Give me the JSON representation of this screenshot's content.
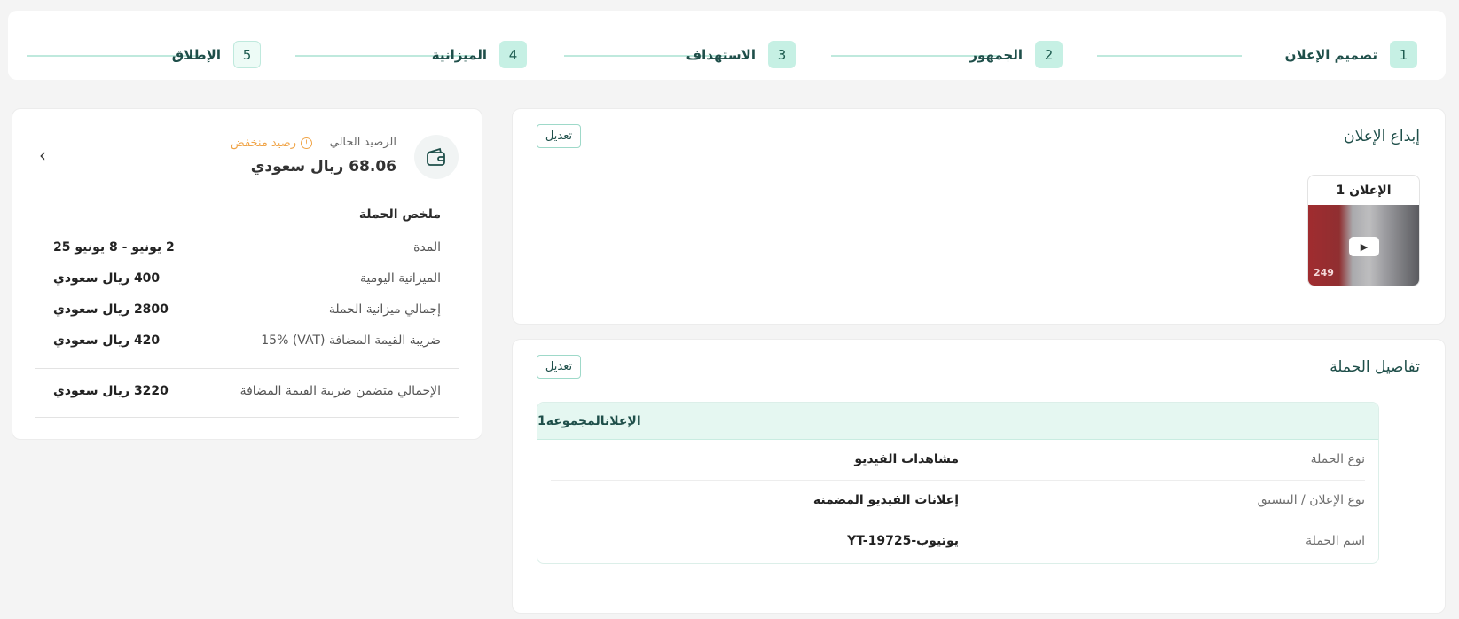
{
  "stepper": {
    "steps": [
      {
        "num": "1",
        "label": "تصميم الإعلان"
      },
      {
        "num": "2",
        "label": "الجمهور"
      },
      {
        "num": "3",
        "label": "الاستهداف"
      },
      {
        "num": "4",
        "label": "الميزانية"
      },
      {
        "num": "5",
        "label": "الإطلاق"
      }
    ]
  },
  "creative": {
    "title": "إبداع الإعلان",
    "edit_label": "تعديل",
    "ad_title": "الإعلان 1",
    "thumb_sign": "249"
  },
  "details": {
    "title": "تفاصيل الحملة",
    "edit_label": "تعديل",
    "group_header": "الإعلانالمجموعة1",
    "rows": [
      {
        "key": "نوع الحملة",
        "value": "مشاهدات الفيديو"
      },
      {
        "key": "نوع الإعلان / التنسيق",
        "value": "إعلانات الفيديو المضمنة"
      },
      {
        "key": "اسم الحملة",
        "value": "يوتيوب-YT-19725"
      }
    ]
  },
  "summary": {
    "balance_label": "الرصيد الحالي",
    "low_balance": "رصيد منخفض",
    "balance_value": "68.06 ريال سعودي",
    "title": "ملخص الحملة",
    "rows": [
      {
        "key": "المدة",
        "value": "2 يونيو - 8 يونيو 25"
      },
      {
        "key": "الميزانية اليومية",
        "value": "400 ريال سعودي"
      },
      {
        "key": "إجمالي ميزانية الحملة",
        "value": "2800 ريال سعودي"
      },
      {
        "key": "ضريبة القيمة المضافة (VAT) 15%",
        "value": "420 ريال سعودي"
      }
    ],
    "total": {
      "key": "الإجمالي متضمن ضريبة القيمة المضافة",
      "value": "3220 ريال سعودي"
    }
  },
  "colors": {
    "accent": "#1f4f4a",
    "step_bg": "#c6f0e4",
    "warning": "#f0a447"
  }
}
